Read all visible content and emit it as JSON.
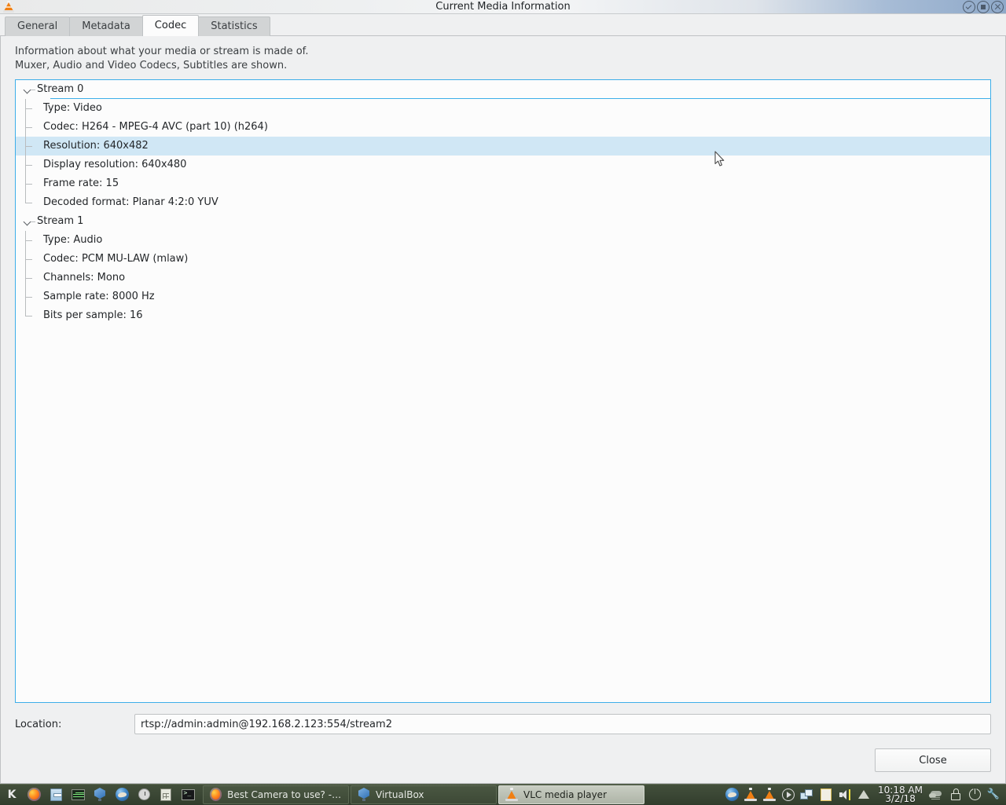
{
  "window": {
    "title": "Current Media Information",
    "app_icon": "vlc-cone-icon",
    "controls": {
      "minimize": "minimize-icon",
      "maximize": "maximize-icon",
      "close": "close-icon"
    }
  },
  "tabs": [
    {
      "label": "General",
      "active": false
    },
    {
      "label": "Metadata",
      "active": false
    },
    {
      "label": "Codec",
      "active": true
    },
    {
      "label": "Statistics",
      "active": false
    }
  ],
  "description": {
    "line1": "Information about what your media or stream is made of.",
    "line2": "Muxer, Audio and Video Codecs, Subtitles are shown."
  },
  "tree": {
    "streams": [
      {
        "label": "Stream 0",
        "expanded": true,
        "focused": true,
        "items": [
          {
            "label": "Type: Video",
            "selected": false
          },
          {
            "label": "Codec: H264 - MPEG-4 AVC (part 10) (h264)",
            "selected": false
          },
          {
            "label": "Resolution: 640x482",
            "selected": true
          },
          {
            "label": "Display resolution: 640x480",
            "selected": false
          },
          {
            "label": "Frame rate: 15",
            "selected": false
          },
          {
            "label": "Decoded format: Planar 4:2:0 YUV",
            "selected": false
          }
        ]
      },
      {
        "label": "Stream 1",
        "expanded": true,
        "focused": false,
        "items": [
          {
            "label": "Type: Audio",
            "selected": false
          },
          {
            "label": "Codec: PCM MU-LAW (mlaw)",
            "selected": false
          },
          {
            "label": "Channels: Mono",
            "selected": false
          },
          {
            "label": "Sample rate: 8000 Hz",
            "selected": false
          },
          {
            "label": "Bits per sample: 16",
            "selected": false
          }
        ]
      }
    ]
  },
  "location": {
    "label": "Location:",
    "value": "rtsp://admin:admin@192.168.2.123:554/stream2",
    "placeholder": ""
  },
  "buttons": {
    "close": "Close"
  },
  "colors": {
    "accent": "#3daee9",
    "selection": "#d0e7f5",
    "window_bg": "#eff0f1",
    "tree_bg": "#fcfcfc",
    "taskbar_bg": "#3b4735"
  },
  "taskbar": {
    "launchers": [
      {
        "name": "kde-menu-icon",
        "label": "K"
      },
      {
        "name": "firefox-icon",
        "label": ""
      },
      {
        "name": "file-manager-icon",
        "label": ""
      },
      {
        "name": "system-monitor-icon",
        "label": ""
      },
      {
        "name": "virtualbox-icon",
        "label": ""
      },
      {
        "name": "thunderbird-icon",
        "label": ""
      },
      {
        "name": "clock-icon",
        "label": ""
      },
      {
        "name": "calculator-icon",
        "label": ""
      },
      {
        "name": "terminal-icon",
        "label": ""
      }
    ],
    "tasks": [
      {
        "label": "Best Camera to use? - Zo...",
        "icon": "firefox-icon",
        "active": false
      },
      {
        "label": "VirtualBox",
        "icon": "virtualbox-icon",
        "active": false
      },
      {
        "label": "VLC media player",
        "icon": "vlc-cone-icon",
        "active": true
      }
    ],
    "tray": [
      {
        "name": "thunderbird-tray-icon"
      },
      {
        "name": "vlc-tray-icon-1"
      },
      {
        "name": "vlc-tray-icon-2"
      },
      {
        "name": "media-play-tray-icon"
      },
      {
        "name": "window-switch-tray-icon"
      },
      {
        "name": "clipboard-tray-icon"
      },
      {
        "name": "volume-tray-icon"
      },
      {
        "name": "show-hidden-tray-icon"
      }
    ],
    "clock": {
      "time": "10:18 AM",
      "date": "3/2/18"
    },
    "tray_right": [
      {
        "name": "weather-tray-icon"
      },
      {
        "name": "lock-screen-icon"
      },
      {
        "name": "power-icon"
      },
      {
        "name": "settings-wrench-icon"
      }
    ]
  }
}
